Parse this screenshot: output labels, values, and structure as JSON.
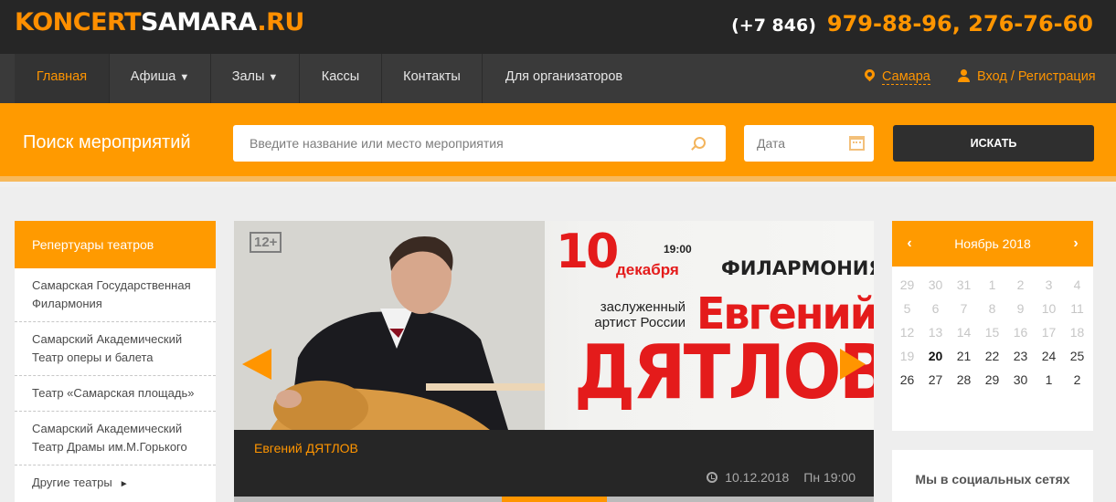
{
  "header": {
    "logo": {
      "part1": "KONCERT",
      "part2": "SAMARA",
      "part3": ".RU"
    },
    "phone_code": "(+7 846)",
    "phone_numbers": "979-88-96, 276-76-60"
  },
  "nav": {
    "items": [
      {
        "label": "Главная",
        "active": true
      },
      {
        "label": "Афиша",
        "dropdown": true
      },
      {
        "label": "Залы",
        "dropdown": true
      },
      {
        "label": "Кассы"
      },
      {
        "label": "Контакты"
      },
      {
        "label": "Для организаторов"
      }
    ],
    "caret": "▼",
    "city": "Самара",
    "login": "Вход / Регистрация"
  },
  "search": {
    "title": "Поиск мероприятий",
    "placeholder": "Введите название или место мероприятия",
    "date_placeholder": "Дата",
    "button": "ИСКАТЬ"
  },
  "sidebar": {
    "title": "Репертуары театров",
    "items": [
      "Самарская Государственная Филармония",
      "Самарский Академический Театр оперы и балета",
      "Театр «Самарская площадь»",
      "Самарский Академический Театр Драмы им.М.Горького",
      "Другие театры"
    ],
    "more_marker": "►"
  },
  "banner": {
    "age": "12+",
    "day": "10",
    "month": "декабря",
    "time": "19:00",
    "venue": "ФИЛАРМОНИЯ",
    "honor": "заслуженный артист России",
    "first_name": "Евгений",
    "last_name": "ДЯТЛОВ"
  },
  "event": {
    "title": "Евгений ДЯТЛОВ",
    "date": "10.12.2018",
    "weekday_time": "Пн 19:00"
  },
  "calendar": {
    "month": "Ноябрь 2018",
    "prev": "‹",
    "next": "›",
    "today": "20",
    "days": [
      {
        "d": "29",
        "cur": false
      },
      {
        "d": "30",
        "cur": false
      },
      {
        "d": "31",
        "cur": false
      },
      {
        "d": "1",
        "cur": false
      },
      {
        "d": "2",
        "cur": false
      },
      {
        "d": "3",
        "cur": false
      },
      {
        "d": "4",
        "cur": false
      },
      {
        "d": "5",
        "cur": false
      },
      {
        "d": "6",
        "cur": false
      },
      {
        "d": "7",
        "cur": false
      },
      {
        "d": "8",
        "cur": false
      },
      {
        "d": "9",
        "cur": false
      },
      {
        "d": "10",
        "cur": false
      },
      {
        "d": "11",
        "cur": false
      },
      {
        "d": "12",
        "cur": false
      },
      {
        "d": "13",
        "cur": false
      },
      {
        "d": "14",
        "cur": false
      },
      {
        "d": "15",
        "cur": false
      },
      {
        "d": "16",
        "cur": false
      },
      {
        "d": "17",
        "cur": false
      },
      {
        "d": "18",
        "cur": false
      },
      {
        "d": "19",
        "cur": false
      },
      {
        "d": "20",
        "cur": true
      },
      {
        "d": "21",
        "cur": true
      },
      {
        "d": "22",
        "cur": true
      },
      {
        "d": "23",
        "cur": true
      },
      {
        "d": "24",
        "cur": true
      },
      {
        "d": "25",
        "cur": true
      },
      {
        "d": "26",
        "cur": true
      },
      {
        "d": "27",
        "cur": true
      },
      {
        "d": "28",
        "cur": true
      },
      {
        "d": "29",
        "cur": true
      },
      {
        "d": "30",
        "cur": true
      },
      {
        "d": "1",
        "cur": true
      },
      {
        "d": "2",
        "cur": true
      }
    ]
  },
  "social": {
    "title": "Мы в социальных сетях"
  },
  "colors": {
    "accent": "#ff9a00",
    "dark": "#262626",
    "nav": "#3a3a3a",
    "banner_red": "#e41b1b"
  }
}
